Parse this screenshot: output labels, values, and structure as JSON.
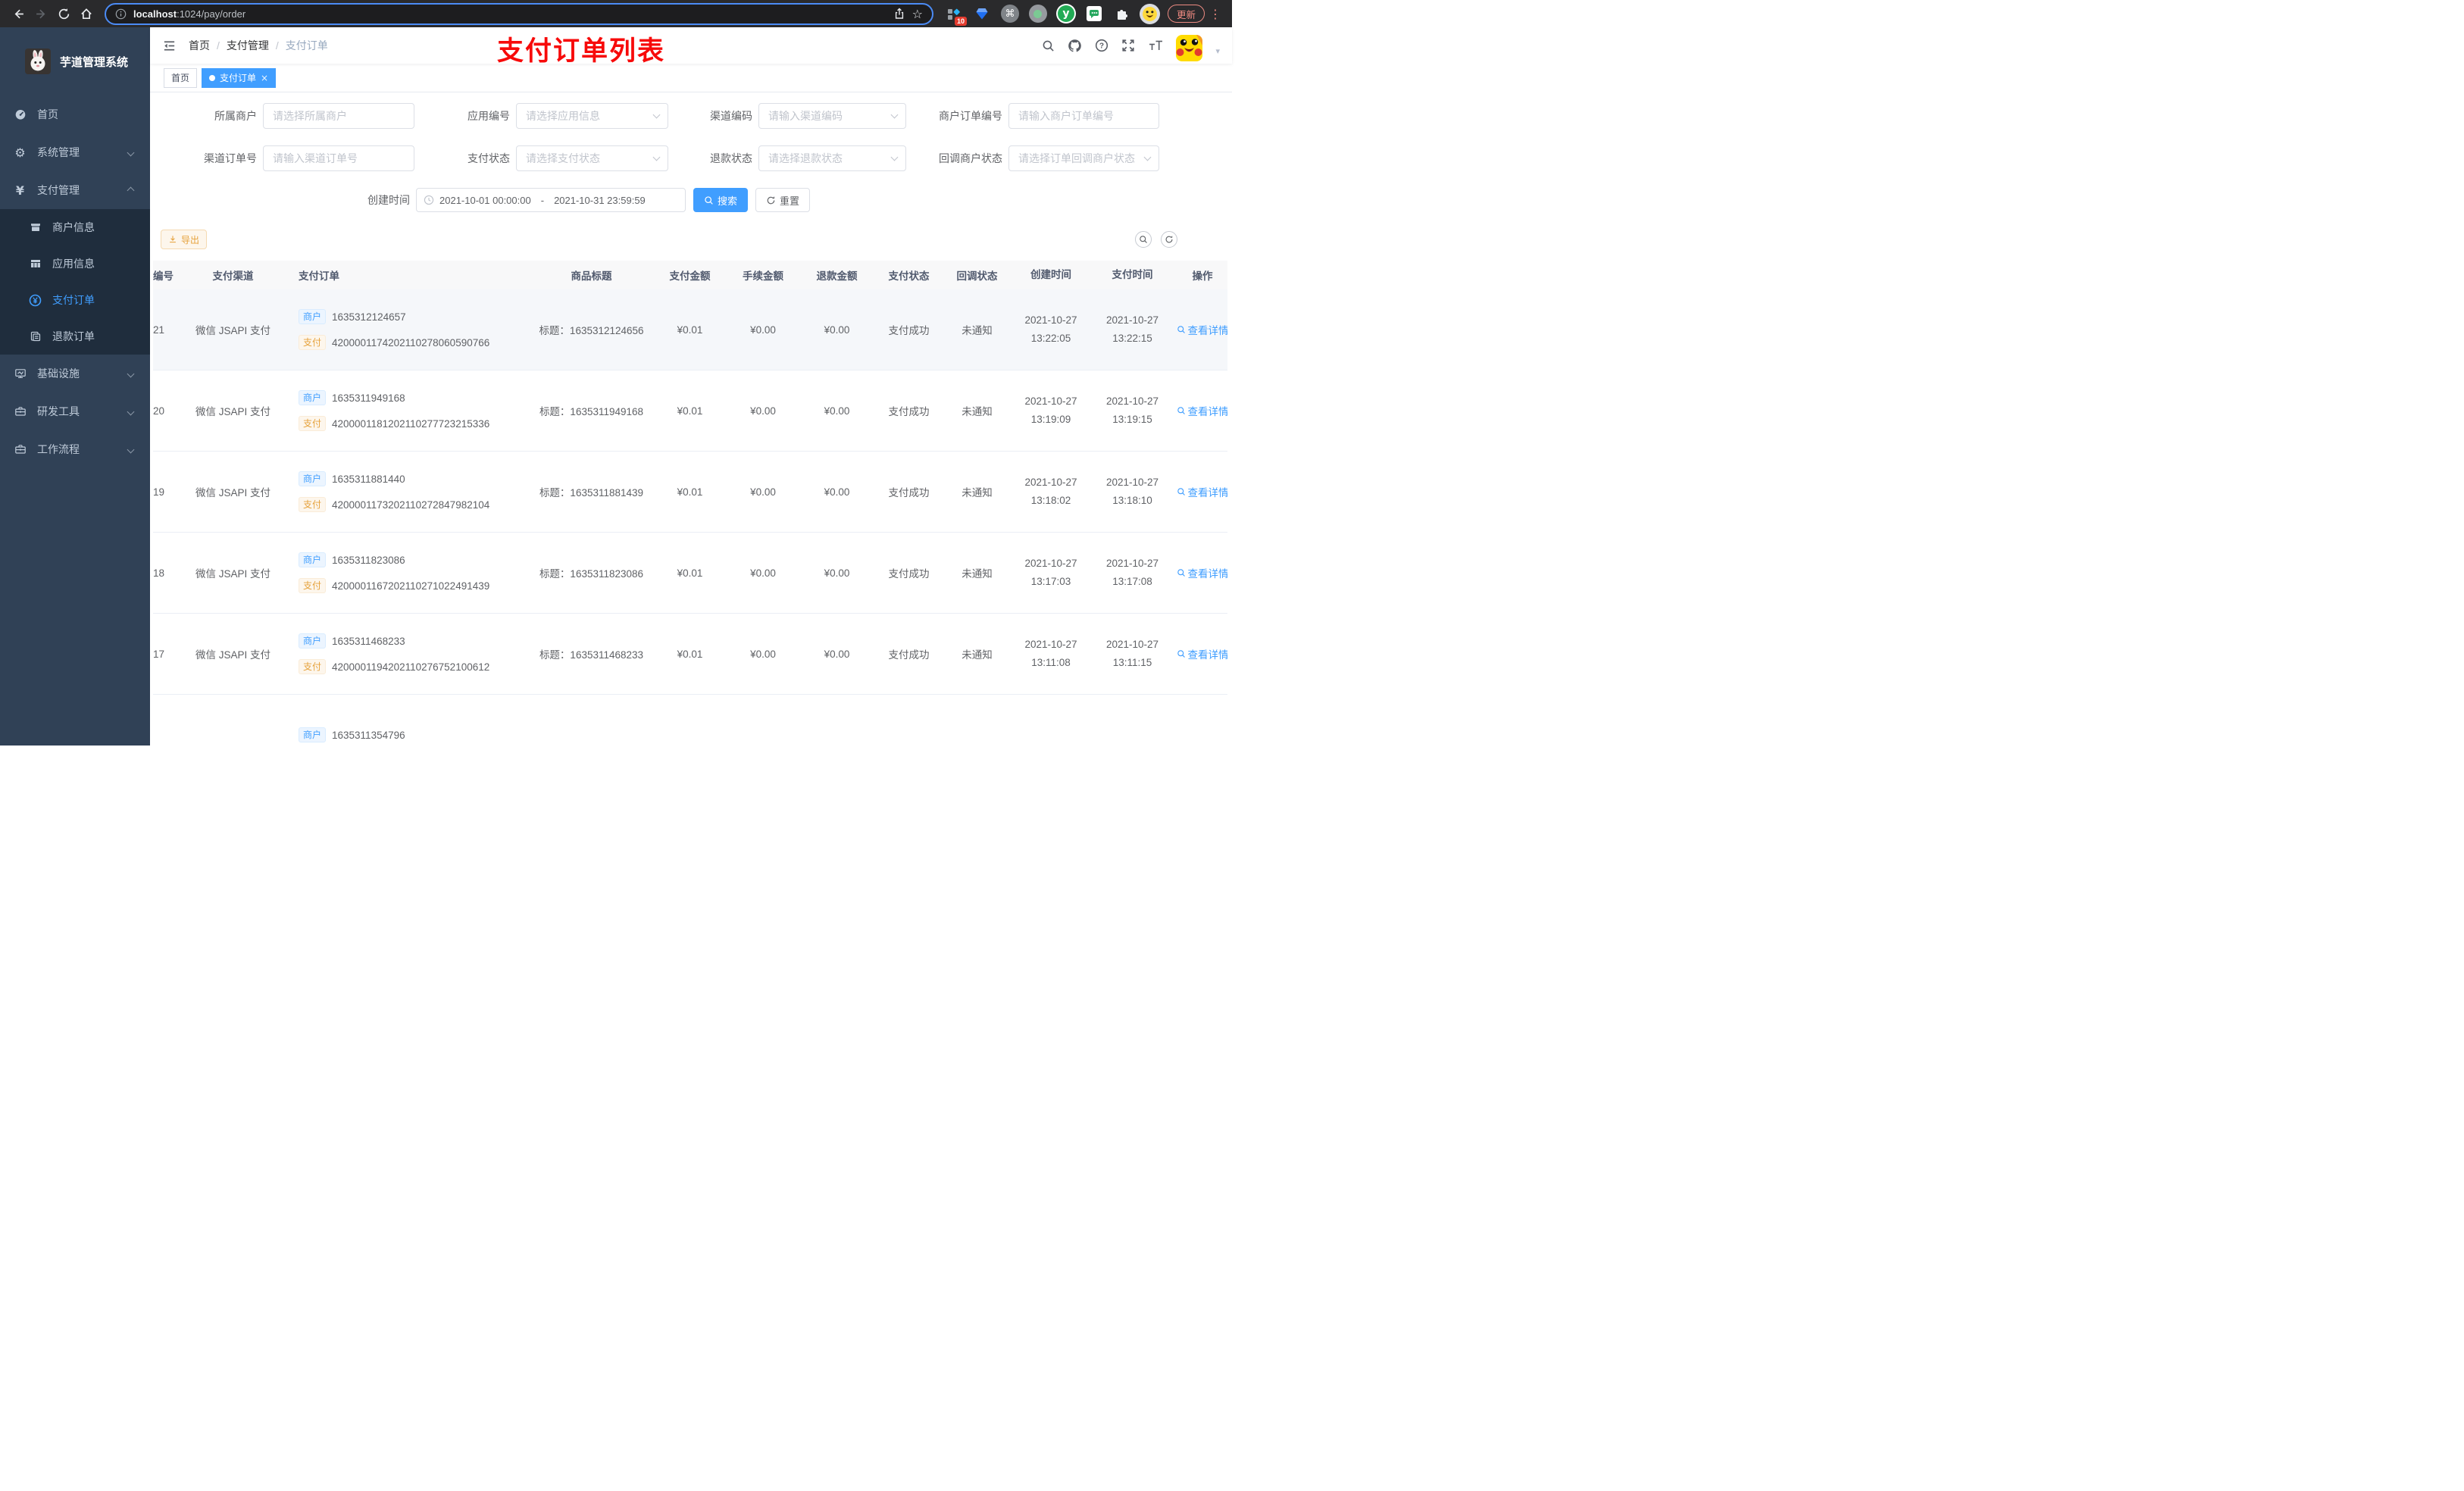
{
  "icons": {
    "question": "?",
    "command": "⌘",
    "yen": "¥",
    "gear": "⚙",
    "letter_y": "y",
    "caret": "▾",
    "close": "×",
    "ellipsis": "⋮",
    "separator": "/",
    "star": "☆"
  },
  "browser": {
    "url_host": "localhost",
    "url_rest": ":1024/pay/order",
    "badge_count": "10",
    "update_label": "更新"
  },
  "sidebar": {
    "title": "芋道管理系统",
    "menu": [
      {
        "label": "首页"
      },
      {
        "label": "系统管理"
      },
      {
        "label": "支付管理"
      },
      {
        "label": "商户信息"
      },
      {
        "label": "应用信息"
      },
      {
        "label": "支付订单"
      },
      {
        "label": "退款订单"
      },
      {
        "label": "基础设施"
      },
      {
        "label": "研发工具"
      },
      {
        "label": "工作流程"
      }
    ]
  },
  "navbar": {
    "breadcrumb": [
      "首页",
      "支付管理",
      "支付订单"
    ],
    "annotation": "支付订单列表"
  },
  "tabs": {
    "home_label": "首页",
    "active_label": "支付订单"
  },
  "filters": {
    "fields": [
      {
        "label": "所属商户",
        "placeholder": "请选择所属商户"
      },
      {
        "label": "应用编号",
        "placeholder": "请选择应用信息"
      },
      {
        "label": "渠道编码",
        "placeholder": "请输入渠道编码"
      },
      {
        "label": "商户订单编号",
        "placeholder": "请输入商户订单编号"
      },
      {
        "label": "渠道订单号",
        "placeholder": "请输入渠道订单号"
      },
      {
        "label": "支付状态",
        "placeholder": "请选择支付状态"
      },
      {
        "label": "退款状态",
        "placeholder": "请选择退款状态"
      },
      {
        "label": "回调商户状态",
        "placeholder": "请选择订单回调商户状态"
      }
    ],
    "date_label": "创建时间",
    "date_start": "2021-10-01 00:00:00",
    "date_separator": "-",
    "date_end": "2021-10-31 23:59:59",
    "search_label": "搜索",
    "reset_label": "重置"
  },
  "toolbar": {
    "export_label": "导出"
  },
  "table": {
    "columns": [
      "编号",
      "支付渠道",
      "支付订单",
      "商品标题",
      "支付金额",
      "手续金额",
      "退款金额",
      "支付状态",
      "回调状态",
      "创建时间",
      "支付时间",
      "操作"
    ],
    "merchant_tag": "商户",
    "pay_tag": "支付",
    "rows": [
      {
        "id": "21",
        "channel": "微信 JSAPI 支付",
        "merchant_no": "1635312124657",
        "pay_no": "4200001174202110278060590766",
        "title": "标题：1635312124656",
        "amount": "¥0.01",
        "fee": "¥0.00",
        "refund": "¥0.00",
        "status": "支付成功",
        "notify": "未通知",
        "create_date": "2021-10-27",
        "create_time": "13:22:05",
        "pay_date": "2021-10-27",
        "pay_time": "13:22:15",
        "action": "查看详情"
      },
      {
        "id": "20",
        "channel": "微信 JSAPI 支付",
        "merchant_no": "1635311949168",
        "pay_no": "4200001181202110277723215336",
        "title": "标题：1635311949168",
        "amount": "¥0.01",
        "fee": "¥0.00",
        "refund": "¥0.00",
        "status": "支付成功",
        "notify": "未通知",
        "create_date": "2021-10-27",
        "create_time": "13:19:09",
        "pay_date": "2021-10-27",
        "pay_time": "13:19:15",
        "action": "查看详情"
      },
      {
        "id": "19",
        "channel": "微信 JSAPI 支付",
        "merchant_no": "1635311881440",
        "pay_no": "4200001173202110272847982104",
        "title": "标题：1635311881439",
        "amount": "¥0.01",
        "fee": "¥0.00",
        "refund": "¥0.00",
        "status": "支付成功",
        "notify": "未通知",
        "create_date": "2021-10-27",
        "create_time": "13:18:02",
        "pay_date": "2021-10-27",
        "pay_time": "13:18:10",
        "action": "查看详情"
      },
      {
        "id": "18",
        "channel": "微信 JSAPI 支付",
        "merchant_no": "1635311823086",
        "pay_no": "4200001167202110271022491439",
        "title": "标题：1635311823086",
        "amount": "¥0.01",
        "fee": "¥0.00",
        "refund": "¥0.00",
        "status": "支付成功",
        "notify": "未通知",
        "create_date": "2021-10-27",
        "create_time": "13:17:03",
        "pay_date": "2021-10-27",
        "pay_time": "13:17:08",
        "action": "查看详情"
      },
      {
        "id": "17",
        "channel": "微信 JSAPI 支付",
        "merchant_no": "1635311468233",
        "pay_no": "4200001194202110276752100612",
        "title": "标题：1635311468233",
        "amount": "¥0.01",
        "fee": "¥0.00",
        "refund": "¥0.00",
        "status": "支付成功",
        "notify": "未通知",
        "create_date": "2021-10-27",
        "create_time": "13:11:08",
        "pay_date": "2021-10-27",
        "pay_time": "13:11:15",
        "action": "查看详情"
      },
      {
        "id": "",
        "channel": "",
        "merchant_no": "1635311354796",
        "pay_no": "",
        "title": "",
        "amount": "",
        "fee": "",
        "refund": "",
        "status": "",
        "notify": "",
        "create_date": "",
        "create_time": "",
        "pay_date": "",
        "pay_time": "",
        "action": ""
      }
    ]
  }
}
